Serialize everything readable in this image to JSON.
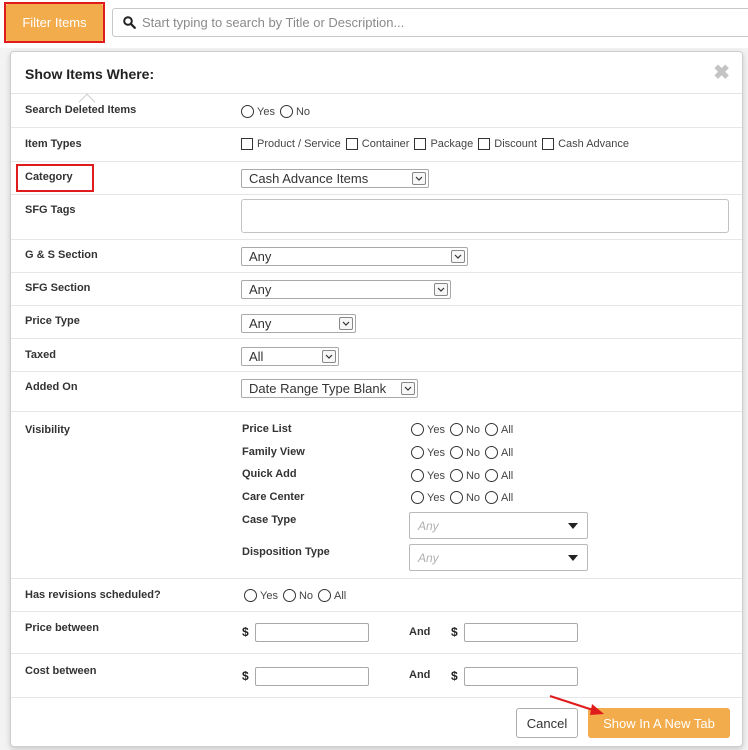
{
  "topbar": {
    "filter_label": "Filter Items",
    "search_placeholder": "Start typing to search by Title or Description..."
  },
  "panel": {
    "title": "Show Items Where:",
    "close_glyph": "✖"
  },
  "fields": {
    "deleted": {
      "label": "Search Deleted Items",
      "options": [
        "Yes",
        "No"
      ]
    },
    "item_types": {
      "label": "Item Types",
      "options": [
        "Product / Service",
        "Container",
        "Package",
        "Discount",
        "Cash Advance"
      ]
    },
    "category": {
      "label": "Category",
      "value": "Cash Advance Items"
    },
    "sfg_tags": {
      "label": "SFG Tags",
      "value": ""
    },
    "gs_section": {
      "label": "G & S Section",
      "value": "Any"
    },
    "sfg_section": {
      "label": "SFG Section",
      "value": "Any"
    },
    "price_type": {
      "label": "Price Type",
      "value": "Any"
    },
    "taxed": {
      "label": "Taxed",
      "value": "All"
    },
    "added_on": {
      "label": "Added On",
      "value": "Date Range Type Blank"
    },
    "visibility": {
      "label": "Visibility",
      "rows": [
        {
          "label": "Price List",
          "options": [
            "Yes",
            "No",
            "All"
          ]
        },
        {
          "label": "Family View",
          "options": [
            "Yes",
            "No",
            "All"
          ]
        },
        {
          "label": "Quick Add",
          "options": [
            "Yes",
            "No",
            "All"
          ]
        },
        {
          "label": "Care Center",
          "options": [
            "Yes",
            "No",
            "All"
          ]
        }
      ],
      "case_type": {
        "label": "Case Type",
        "placeholder": "Any"
      },
      "disposition_type": {
        "label": "Disposition Type",
        "placeholder": "Any"
      }
    },
    "revisions": {
      "label": "Has revisions scheduled?",
      "options": [
        "Yes",
        "No",
        "All"
      ]
    },
    "price_between": {
      "label": "Price between",
      "currency": "$",
      "and": "And"
    },
    "cost_between": {
      "label": "Cost between",
      "currency": "$",
      "and": "And"
    }
  },
  "footer": {
    "cancel_label": "Cancel",
    "newtab_label": "Show In A New Tab"
  },
  "colors": {
    "accent": "#f2ac4b",
    "annotation": "#e01b1b"
  }
}
